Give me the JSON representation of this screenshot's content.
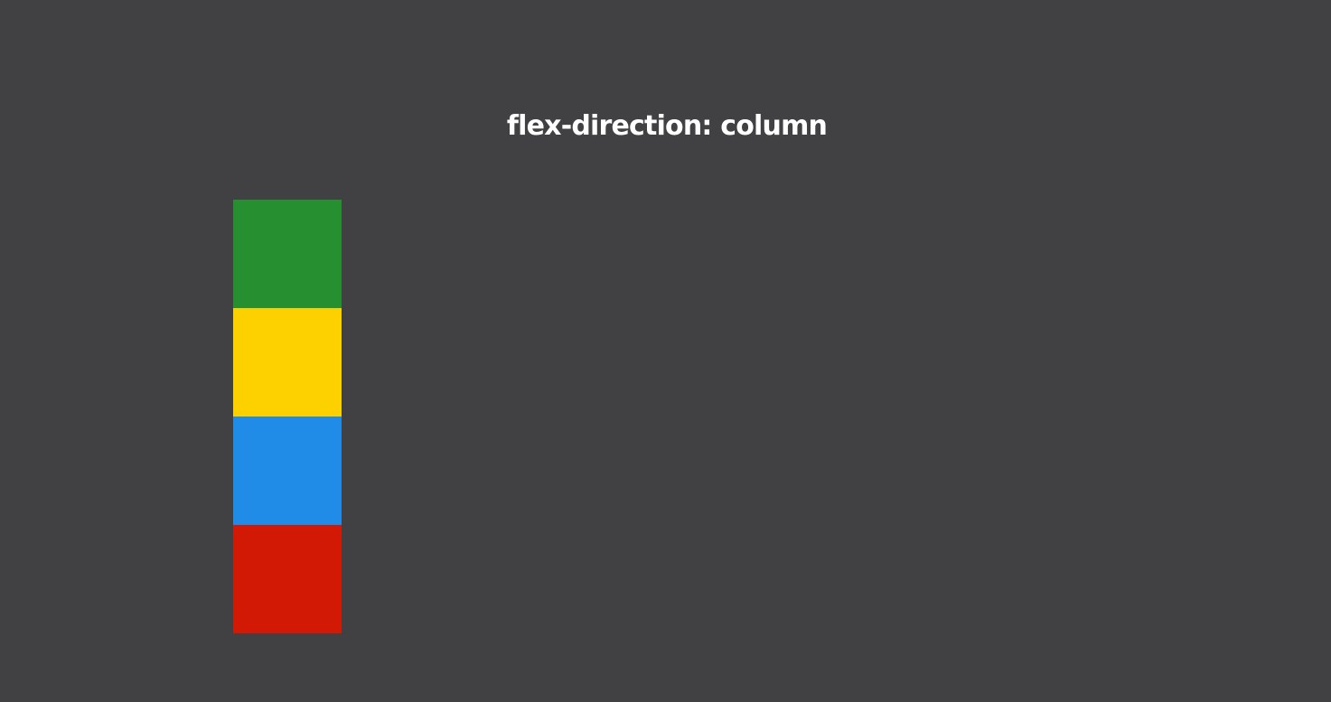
{
  "page": {
    "title": "flex-direction: column",
    "background": "#414042"
  },
  "flex_demo": {
    "items": [
      {
        "name": "flex-item-green",
        "color": "#268f2f"
      },
      {
        "name": "flex-item-yellow",
        "color": "#fdd000"
      },
      {
        "name": "flex-item-blue",
        "color": "#218be8"
      },
      {
        "name": "flex-item-red",
        "color": "#d21905"
      }
    ]
  }
}
